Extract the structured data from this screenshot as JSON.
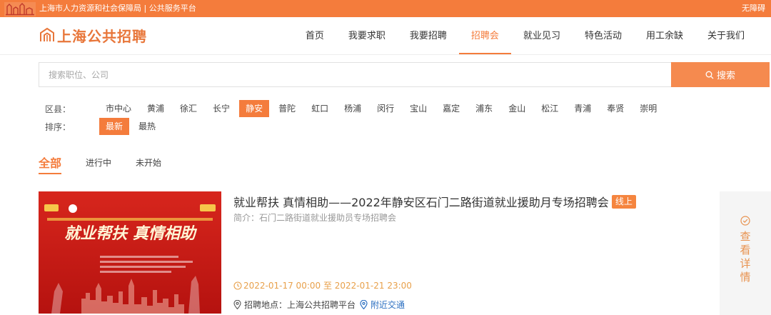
{
  "topbar": {
    "gov_text": "上海市人力资源和社会保障局 | 公共服务平台",
    "accessibility": "无障碍"
  },
  "header": {
    "brand": "上海公共招聘",
    "nav": [
      {
        "label": "首页",
        "active": false
      },
      {
        "label": "我要求职",
        "active": false
      },
      {
        "label": "我要招聘",
        "active": false
      },
      {
        "label": "招聘会",
        "active": true
      },
      {
        "label": "就业见习",
        "active": false
      },
      {
        "label": "特色活动",
        "active": false
      },
      {
        "label": "用工余缺",
        "active": false
      },
      {
        "label": "关于我们",
        "active": false
      }
    ]
  },
  "search": {
    "placeholder": "搜索职位、公司",
    "value": "",
    "button_label": "搜索"
  },
  "filters": {
    "district_label": "区县：",
    "districts": [
      "市中心",
      "黄浦",
      "徐汇",
      "长宁",
      "静安",
      "普陀",
      "虹口",
      "杨浦",
      "闵行",
      "宝山",
      "嘉定",
      "浦东",
      "金山",
      "松江",
      "青浦",
      "奉贤",
      "崇明"
    ],
    "selected_district": "静安",
    "sort_label": "排序：",
    "sorts": [
      "最新",
      "最热"
    ],
    "selected_sort": "最新"
  },
  "tabs": [
    {
      "label": "全部",
      "active": true
    },
    {
      "label": "进行中",
      "active": false
    },
    {
      "label": "未开始",
      "active": false
    }
  ],
  "fair": {
    "title": "就业帮扶 真情相助——2022年静安区石门二路街道就业援助月专场招聘会",
    "badge": "线上",
    "intro": "简介：石门二路街道就业援助员专场招聘会",
    "date": "2022-01-17 00:00 至 2022-01-21 23:00",
    "location": "招聘地点：上海公共招聘平台",
    "transport": "附近交通",
    "detail_label": "查看详情",
    "poster_headline": "就业帮扶 真情相助"
  },
  "colors": {
    "accent": "#f47c3c",
    "link": "#2b6fc1",
    "date": "#e8a04a"
  }
}
